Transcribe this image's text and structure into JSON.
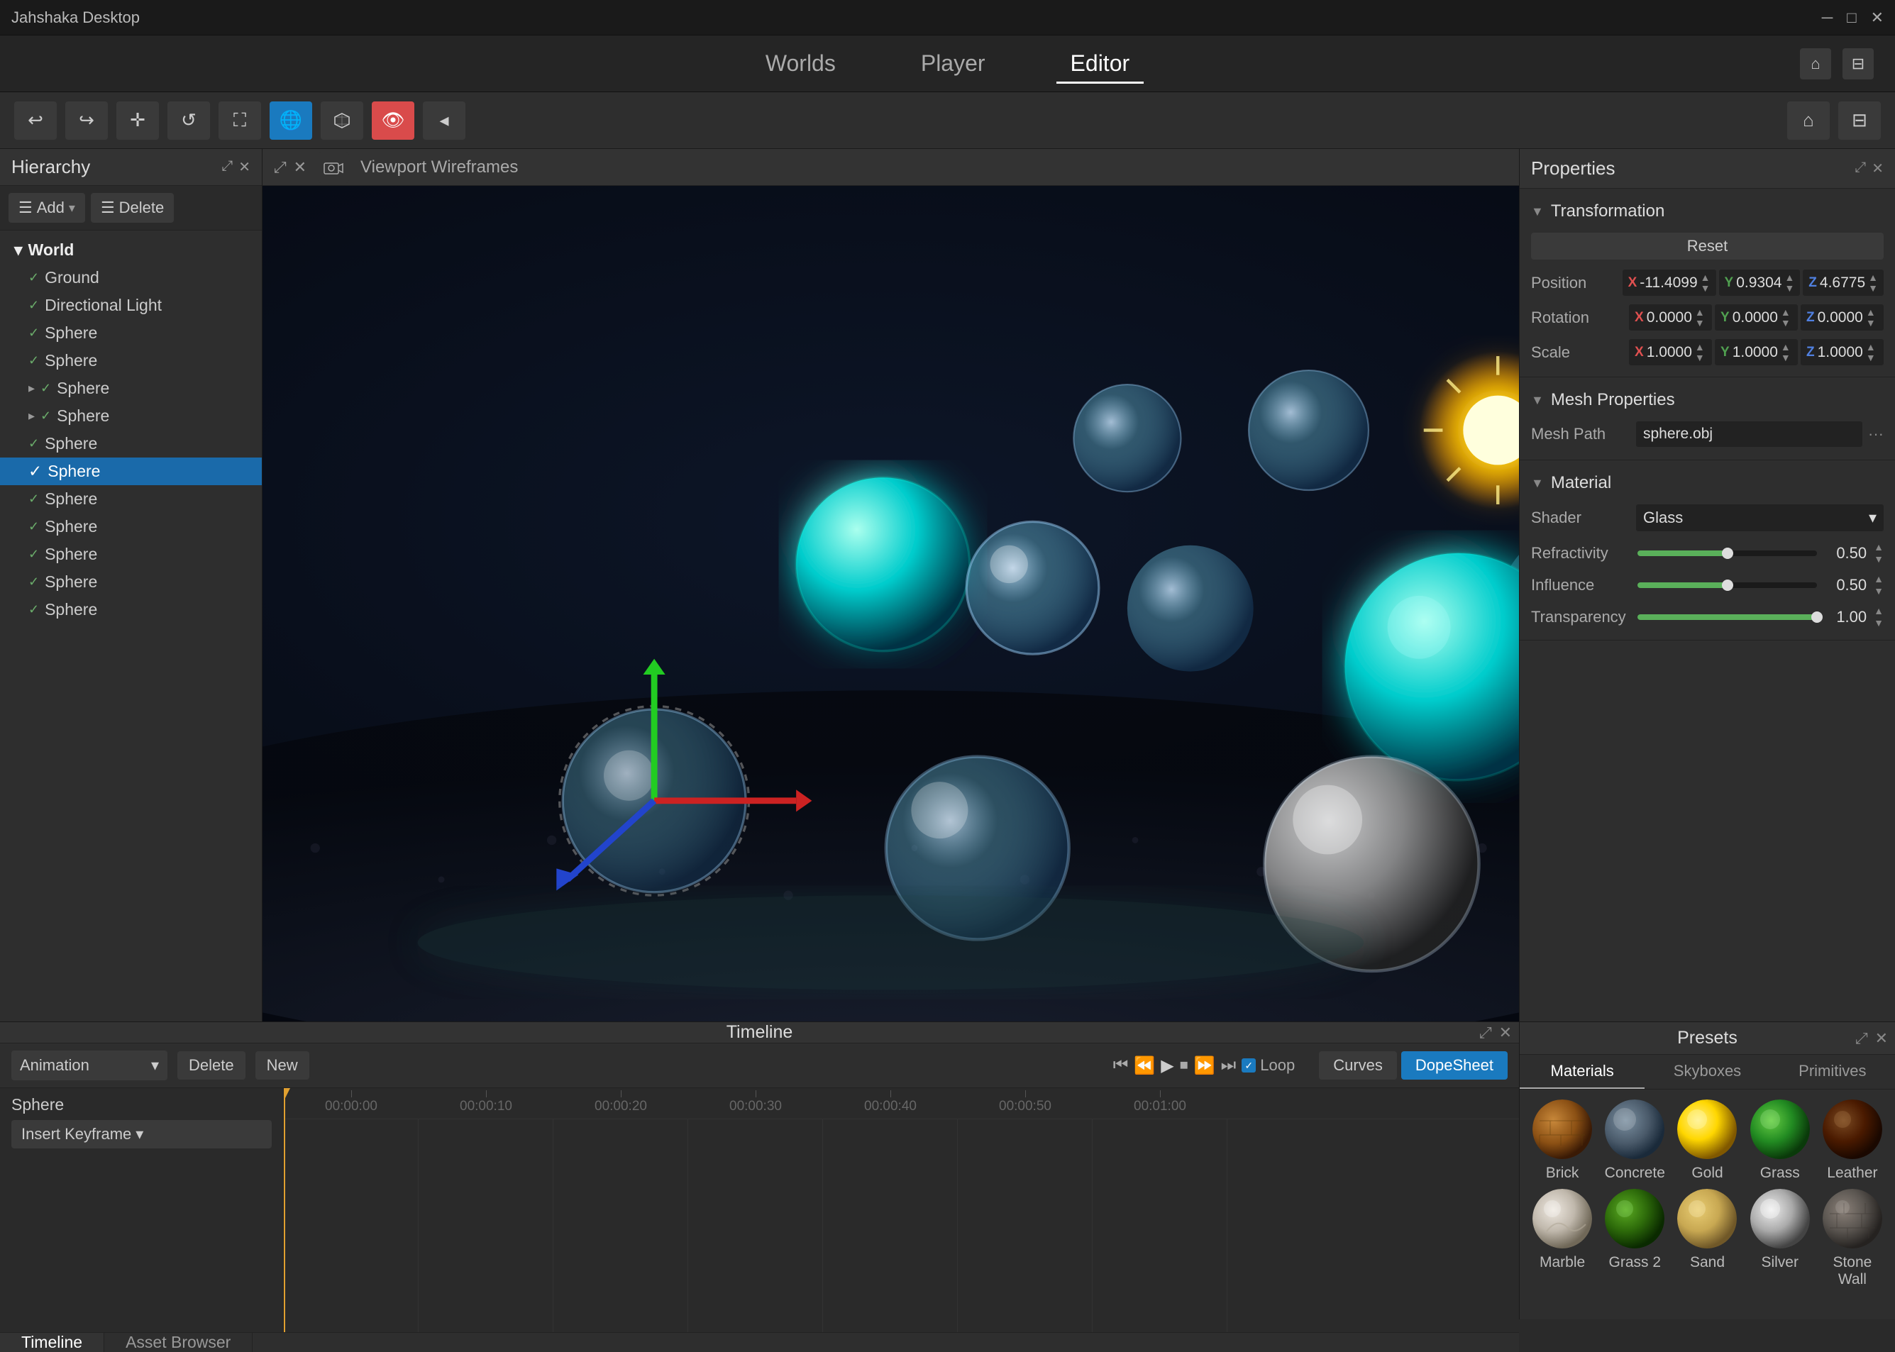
{
  "app": {
    "title": "Jahshaka Desktop",
    "window_controls": [
      "minimize",
      "maximize",
      "close"
    ]
  },
  "nav": {
    "items": [
      {
        "label": "Worlds",
        "active": false
      },
      {
        "label": "Player",
        "active": false
      },
      {
        "label": "Editor",
        "active": true
      }
    ]
  },
  "toolbar": {
    "tools": [
      {
        "name": "undo",
        "icon": "↩",
        "active": false
      },
      {
        "name": "redo",
        "icon": "↪",
        "active": false
      },
      {
        "name": "move",
        "icon": "✛",
        "active": false
      },
      {
        "name": "rotate-reset",
        "icon": "↺",
        "active": false
      },
      {
        "name": "fullscreen",
        "icon": "⛶",
        "active": false
      },
      {
        "name": "world",
        "icon": "🌐",
        "active": true
      },
      {
        "name": "cube",
        "icon": "⬡",
        "active": false
      },
      {
        "name": "eye",
        "icon": "👁",
        "active": true
      },
      {
        "name": "back",
        "icon": "◂",
        "active": false
      }
    ],
    "right": [
      {
        "name": "home",
        "icon": "⌂"
      },
      {
        "name": "gamepad",
        "icon": "⊡"
      }
    ]
  },
  "hierarchy": {
    "title": "Hierarchy",
    "add_label": "Add",
    "delete_label": "Delete",
    "world_label": "World",
    "items": [
      {
        "label": "Ground",
        "indent": 1,
        "checked": true,
        "expanded": false
      },
      {
        "label": "Directional Light",
        "indent": 1,
        "checked": true,
        "expanded": false
      },
      {
        "label": "Sphere",
        "indent": 1,
        "checked": true,
        "expanded": false
      },
      {
        "label": "Sphere",
        "indent": 1,
        "checked": true,
        "expanded": false
      },
      {
        "label": "Sphere",
        "indent": 1,
        "checked": true,
        "expanded": true
      },
      {
        "label": "Sphere",
        "indent": 1,
        "checked": true,
        "expanded": true
      },
      {
        "label": "Sphere",
        "indent": 1,
        "checked": true,
        "expanded": false
      },
      {
        "label": "Sphere",
        "indent": 1,
        "checked": true,
        "expanded": false,
        "selected": true
      },
      {
        "label": "Sphere",
        "indent": 1,
        "checked": true,
        "expanded": false
      },
      {
        "label": "Sphere",
        "indent": 1,
        "checked": true,
        "expanded": false
      },
      {
        "label": "Sphere",
        "indent": 1,
        "checked": true,
        "expanded": false
      },
      {
        "label": "Sphere",
        "indent": 1,
        "checked": true,
        "expanded": false
      },
      {
        "label": "Sphere",
        "indent": 1,
        "checked": true,
        "expanded": false
      }
    ]
  },
  "viewport": {
    "wireframes_label": "Viewport Wireframes"
  },
  "properties": {
    "title": "Properties",
    "transformation_label": "Transformation",
    "reset_label": "Reset",
    "position_label": "Position",
    "rotation_label": "Rotation",
    "scale_label": "Scale",
    "position": {
      "x": "-11.4099",
      "y": "0.9304",
      "z": "4.6775"
    },
    "rotation": {
      "x": "0.0000",
      "y": "0.0000",
      "z": "0.0000"
    },
    "scale": {
      "x": "1.0000",
      "y": "1.0000",
      "z": "1.0000"
    },
    "mesh_properties_label": "Mesh Properties",
    "mesh_path_label": "Mesh Path",
    "mesh_path_value": "sphere.obj",
    "material_label": "Material",
    "shader_label": "Shader",
    "shader_value": "Glass",
    "refractivity_label": "Refractivity",
    "refractivity_value": "0.50",
    "refractivity_pct": 50,
    "influence_label": "Influence",
    "influence_value": "0.50",
    "influence_pct": 50,
    "transparency_label": "Transparency",
    "transparency_value": "1.00",
    "transparency_pct": 100
  },
  "timeline": {
    "title": "Timeline",
    "animation_label": "Animation",
    "delete_label": "Delete",
    "new_label": "New",
    "loop_label": "Loop",
    "curves_label": "Curves",
    "dopesheet_label": "DopeSheet",
    "track_label": "Sphere",
    "insert_keyframe_label": "Insert Keyframe",
    "time_markers": [
      "00:00:00",
      "00:00:10",
      "00:00:20",
      "00:00:30",
      "00:00:40",
      "00:00:50",
      "00:01:00"
    ]
  },
  "presets": {
    "title": "Presets",
    "tabs": [
      "Materials",
      "Skyboxes",
      "Primitives"
    ],
    "active_tab": "Materials",
    "materials": [
      {
        "label": "Brick",
        "color1": "#8B6914",
        "color2": "#5a3a0a"
      },
      {
        "label": "Concrete",
        "color1": "#5a6a7a",
        "color2": "#3a4a5a"
      },
      {
        "label": "Gold",
        "color1": "#FFD700",
        "color2": "#B8860B"
      },
      {
        "label": "Grass",
        "color1": "#228B22",
        "color2": "#006400"
      },
      {
        "label": "Leather",
        "color1": "#5a2a0a",
        "color2": "#3a1a00"
      },
      {
        "label": "Marble",
        "color1": "#e0d8cc",
        "color2": "#b0a898"
      },
      {
        "label": "Grass 2",
        "color1": "#2d6a0a",
        "color2": "#1a4a00"
      },
      {
        "label": "Sand",
        "color1": "#c8a852",
        "color2": "#a07830"
      },
      {
        "label": "Silver",
        "color1": "#c0c0c0",
        "color2": "#808080"
      },
      {
        "label": "Stone Wall",
        "color1": "#6a6560",
        "color2": "#4a4540"
      }
    ]
  },
  "bottom_tabs": [
    {
      "label": "Timeline",
      "active": true
    },
    {
      "label": "Asset Browser",
      "active": false
    }
  ]
}
